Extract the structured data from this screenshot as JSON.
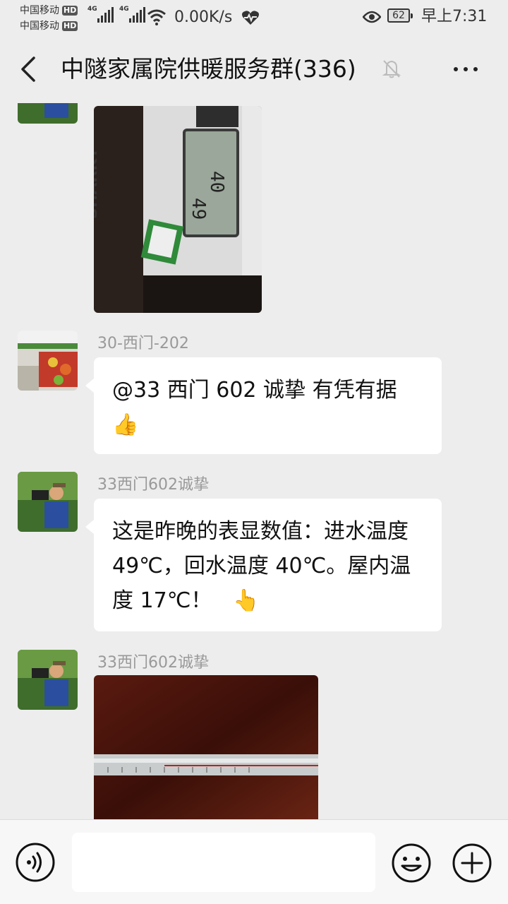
{
  "status_bar": {
    "carrier1": "中国移动",
    "carrier2": "中国移动",
    "hd_label": "HD",
    "network_tag": "4G",
    "net_speed": "0.00K/s",
    "battery": "62",
    "time": "早上7:31"
  },
  "header": {
    "title": "中隧家属院供暖服务群(336)"
  },
  "messages": [
    {
      "type": "image",
      "meter_brand": "SHARKY",
      "meter_reading_top": "40",
      "meter_reading_bottom": "49"
    },
    {
      "type": "text",
      "sender": "30-西门-202",
      "text": "@33 西门 602 诚挚  有凭有据",
      "emoji": "👍"
    },
    {
      "type": "text",
      "sender": "33西门602诚挚",
      "text": "这是昨晚的表显数值：进水温度 49℃，回水温度 40℃。屋内温度 17℃！",
      "emoji": "👆"
    },
    {
      "type": "image",
      "sender": "33西门602诚挚"
    }
  ],
  "input": {
    "placeholder": ""
  }
}
